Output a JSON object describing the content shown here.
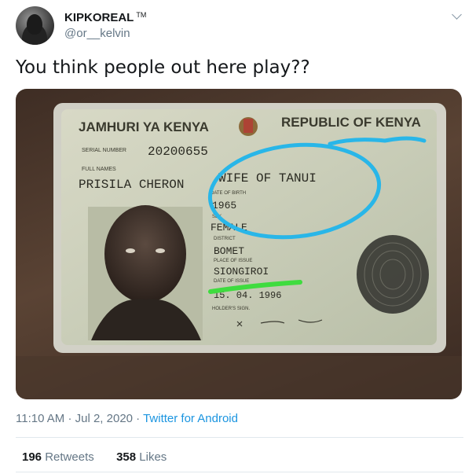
{
  "author": {
    "name": "KIPKOREAL",
    "badge": "TM",
    "handle": "@or__kelvin"
  },
  "tweet": {
    "text": "You think people out here play??"
  },
  "id_card": {
    "header_left": "JAMHURI YA KENYA",
    "header_right": "REPUBLIC OF KENYA",
    "serial_label": "SERIAL NUMBER",
    "serial_number": "20200655",
    "full_names_label": "FULL NAMES",
    "full_names": "PRISILA CHERON",
    "wife_of": "WIFE OF TANUI",
    "dob_label": "DATE OF BIRTH",
    "dob": "1965",
    "sex_label": "SEX",
    "sex": "FEMALE",
    "district_label": "DISTRICT",
    "district": "BOMET",
    "place_label": "PLACE OF ISSUE",
    "place": "SIONGIROI",
    "issue_label": "DATE OF ISSUE",
    "issue_date": "15. 04. 1996",
    "sign_label": "HOLDER'S SIGN.",
    "highlight_circle_color": "#29b6e8",
    "highlight_line_color": "#3fdc3f"
  },
  "meta": {
    "time": "11:10 AM",
    "separator": "·",
    "date": "Jul 2, 2020",
    "source": "Twitter for Android"
  },
  "stats": {
    "retweets_count": "196",
    "retweets_label": "Retweets",
    "likes_count": "358",
    "likes_label": "Likes"
  }
}
